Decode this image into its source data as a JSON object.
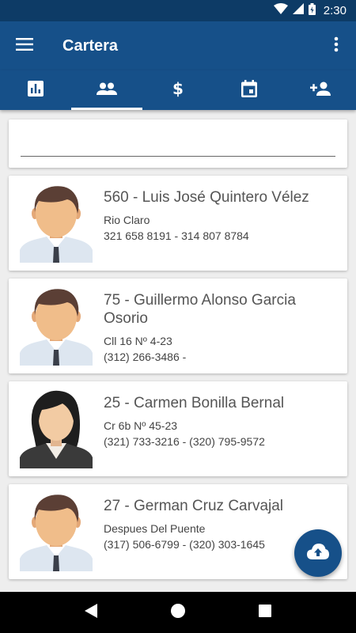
{
  "status_bar": {
    "time": "2:30"
  },
  "app_bar": {
    "title": "Cartera"
  },
  "tabs": [
    {
      "icon": "bar-chart-icon",
      "active": false
    },
    {
      "icon": "people-icon",
      "active": true
    },
    {
      "icon": "dollar-icon",
      "active": false
    },
    {
      "icon": "calendar-icon",
      "active": false
    },
    {
      "icon": "add-person-icon",
      "active": false
    }
  ],
  "search": {
    "value": "",
    "placeholder": ""
  },
  "clients": [
    {
      "name": "560 - Luis José Quintero Vélez",
      "address": "Rio Claro",
      "phones": "321 658 8191 - 314 807 8784",
      "avatar": "male-avatar-icon"
    },
    {
      "name": "75 - Guillermo Alonso Garcia Osorio",
      "address": "Cll 16 Nº 4-23",
      "phones": "(312) 266-3486 -",
      "avatar": "male-avatar-icon"
    },
    {
      "name": "25 - Carmen Bonilla Bernal",
      "address": "Cr 6b Nº 45-23",
      "phones": "(321) 733-3216 - (320) 795-9572",
      "avatar": "female-avatar-icon"
    },
    {
      "name": "27 - German Cruz Carvajal",
      "address": "Despues Del Puente",
      "phones": "(317) 506-6799 - (320) 303-1645",
      "avatar": "male-avatar-icon"
    }
  ],
  "fab": {
    "icon": "cloud-upload-icon"
  },
  "colors": {
    "primary": "#165089",
    "status": "#0d3b66"
  }
}
